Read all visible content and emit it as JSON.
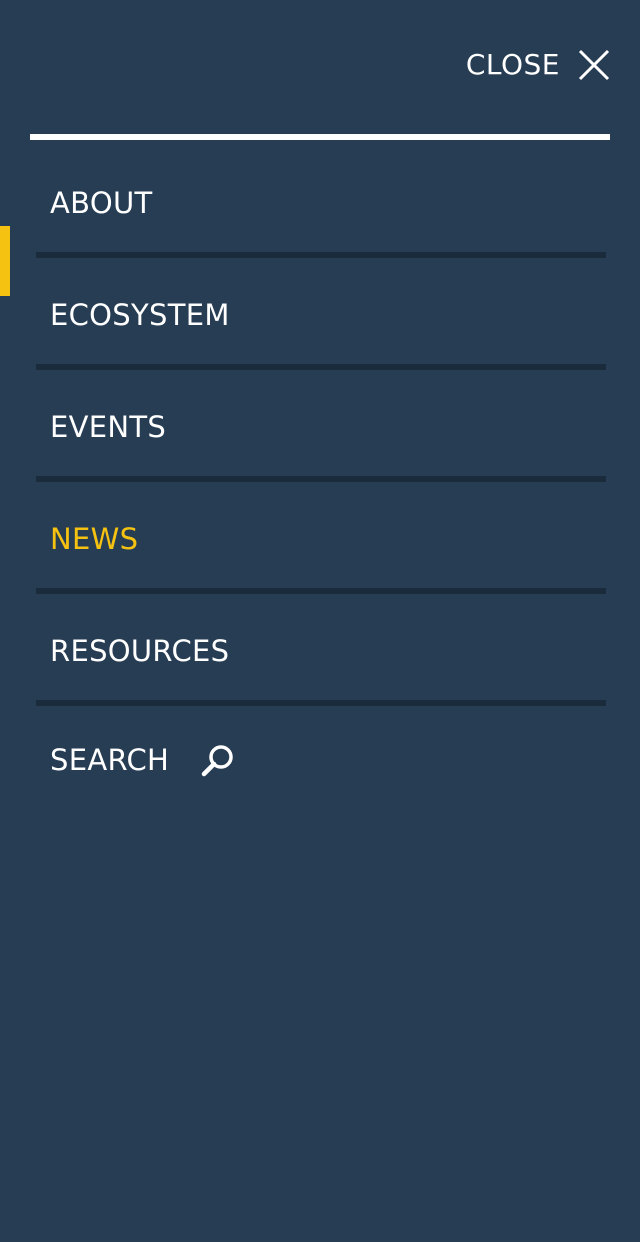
{
  "header": {
    "close_label": "CLOSE",
    "close_icon": "close-icon"
  },
  "nav": {
    "items": [
      {
        "label": "ABOUT",
        "active": false
      },
      {
        "label": "ECOSYSTEM",
        "active": false
      },
      {
        "label": "EVENTS",
        "active": false
      },
      {
        "label": "NEWS",
        "active": true
      },
      {
        "label": "RESOURCES",
        "active": false
      }
    ],
    "search_label": "SEARCH",
    "search_icon": "search-icon"
  },
  "colors": {
    "background": "#273d54",
    "text": "#ffffff",
    "accent": "#f5c211",
    "divider": "#1a2b3b"
  }
}
